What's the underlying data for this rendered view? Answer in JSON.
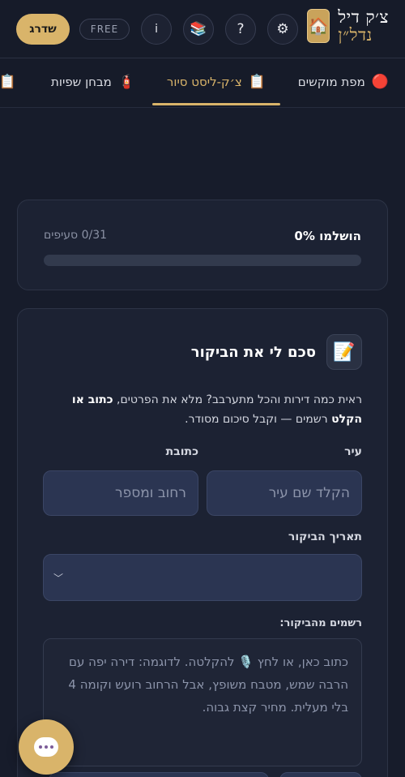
{
  "header": {
    "brand_line1": "צ׳ק דיל",
    "brand_line2": "נדל״ן",
    "logo_icon": "house-icon",
    "settings_icon": "gear-icon",
    "help_label": "?",
    "library_icon": "books-icon",
    "info_label": "i",
    "free_badge": "FREE",
    "upgrade_label": "שדרג"
  },
  "tabs": [
    {
      "label": "מפת מוקשים",
      "icon": "red-circle-icon"
    },
    {
      "label": "צ׳ק-ליסט סיור",
      "icon": "clipboard-icon"
    },
    {
      "label": "מבחן שפיות",
      "icon": "fire-extinguisher-icon"
    }
  ],
  "progress": {
    "title": "הושלמו 0%",
    "count": "0/31 סעיפים",
    "percent": 0
  },
  "summary": {
    "icon": "memo-icon",
    "title": "סכם לי את הביקור",
    "desc_part1": "ראית כמה דירות והכל מתערבב? מלא את הפרטים, ",
    "desc_bold": "כתוב או הקלט",
    "desc_part2": " רשמים — וקבל סיכום מסודר.",
    "city_label": "עיר",
    "city_placeholder": "הקלד שם עיר",
    "address_label": "כתובת",
    "address_placeholder": "רחוב ומספר",
    "date_label": "תאריך הביקור",
    "notes_label": "רשמים מהביקור:",
    "notes_placeholder": "כתוב כאן, או לחץ 🎙️ להקלטה. לדוגמה: דירה יפה עם הרבה שמש, מטבח משופץ, אבל הרחוב רועש וקומה 4 בלי מעלית. מחיר קצת גבוה."
  },
  "colors": {
    "background": "#171c2b",
    "accent_gold": "#d9b46a",
    "card": "#1c2233",
    "input": "#2b3552"
  }
}
